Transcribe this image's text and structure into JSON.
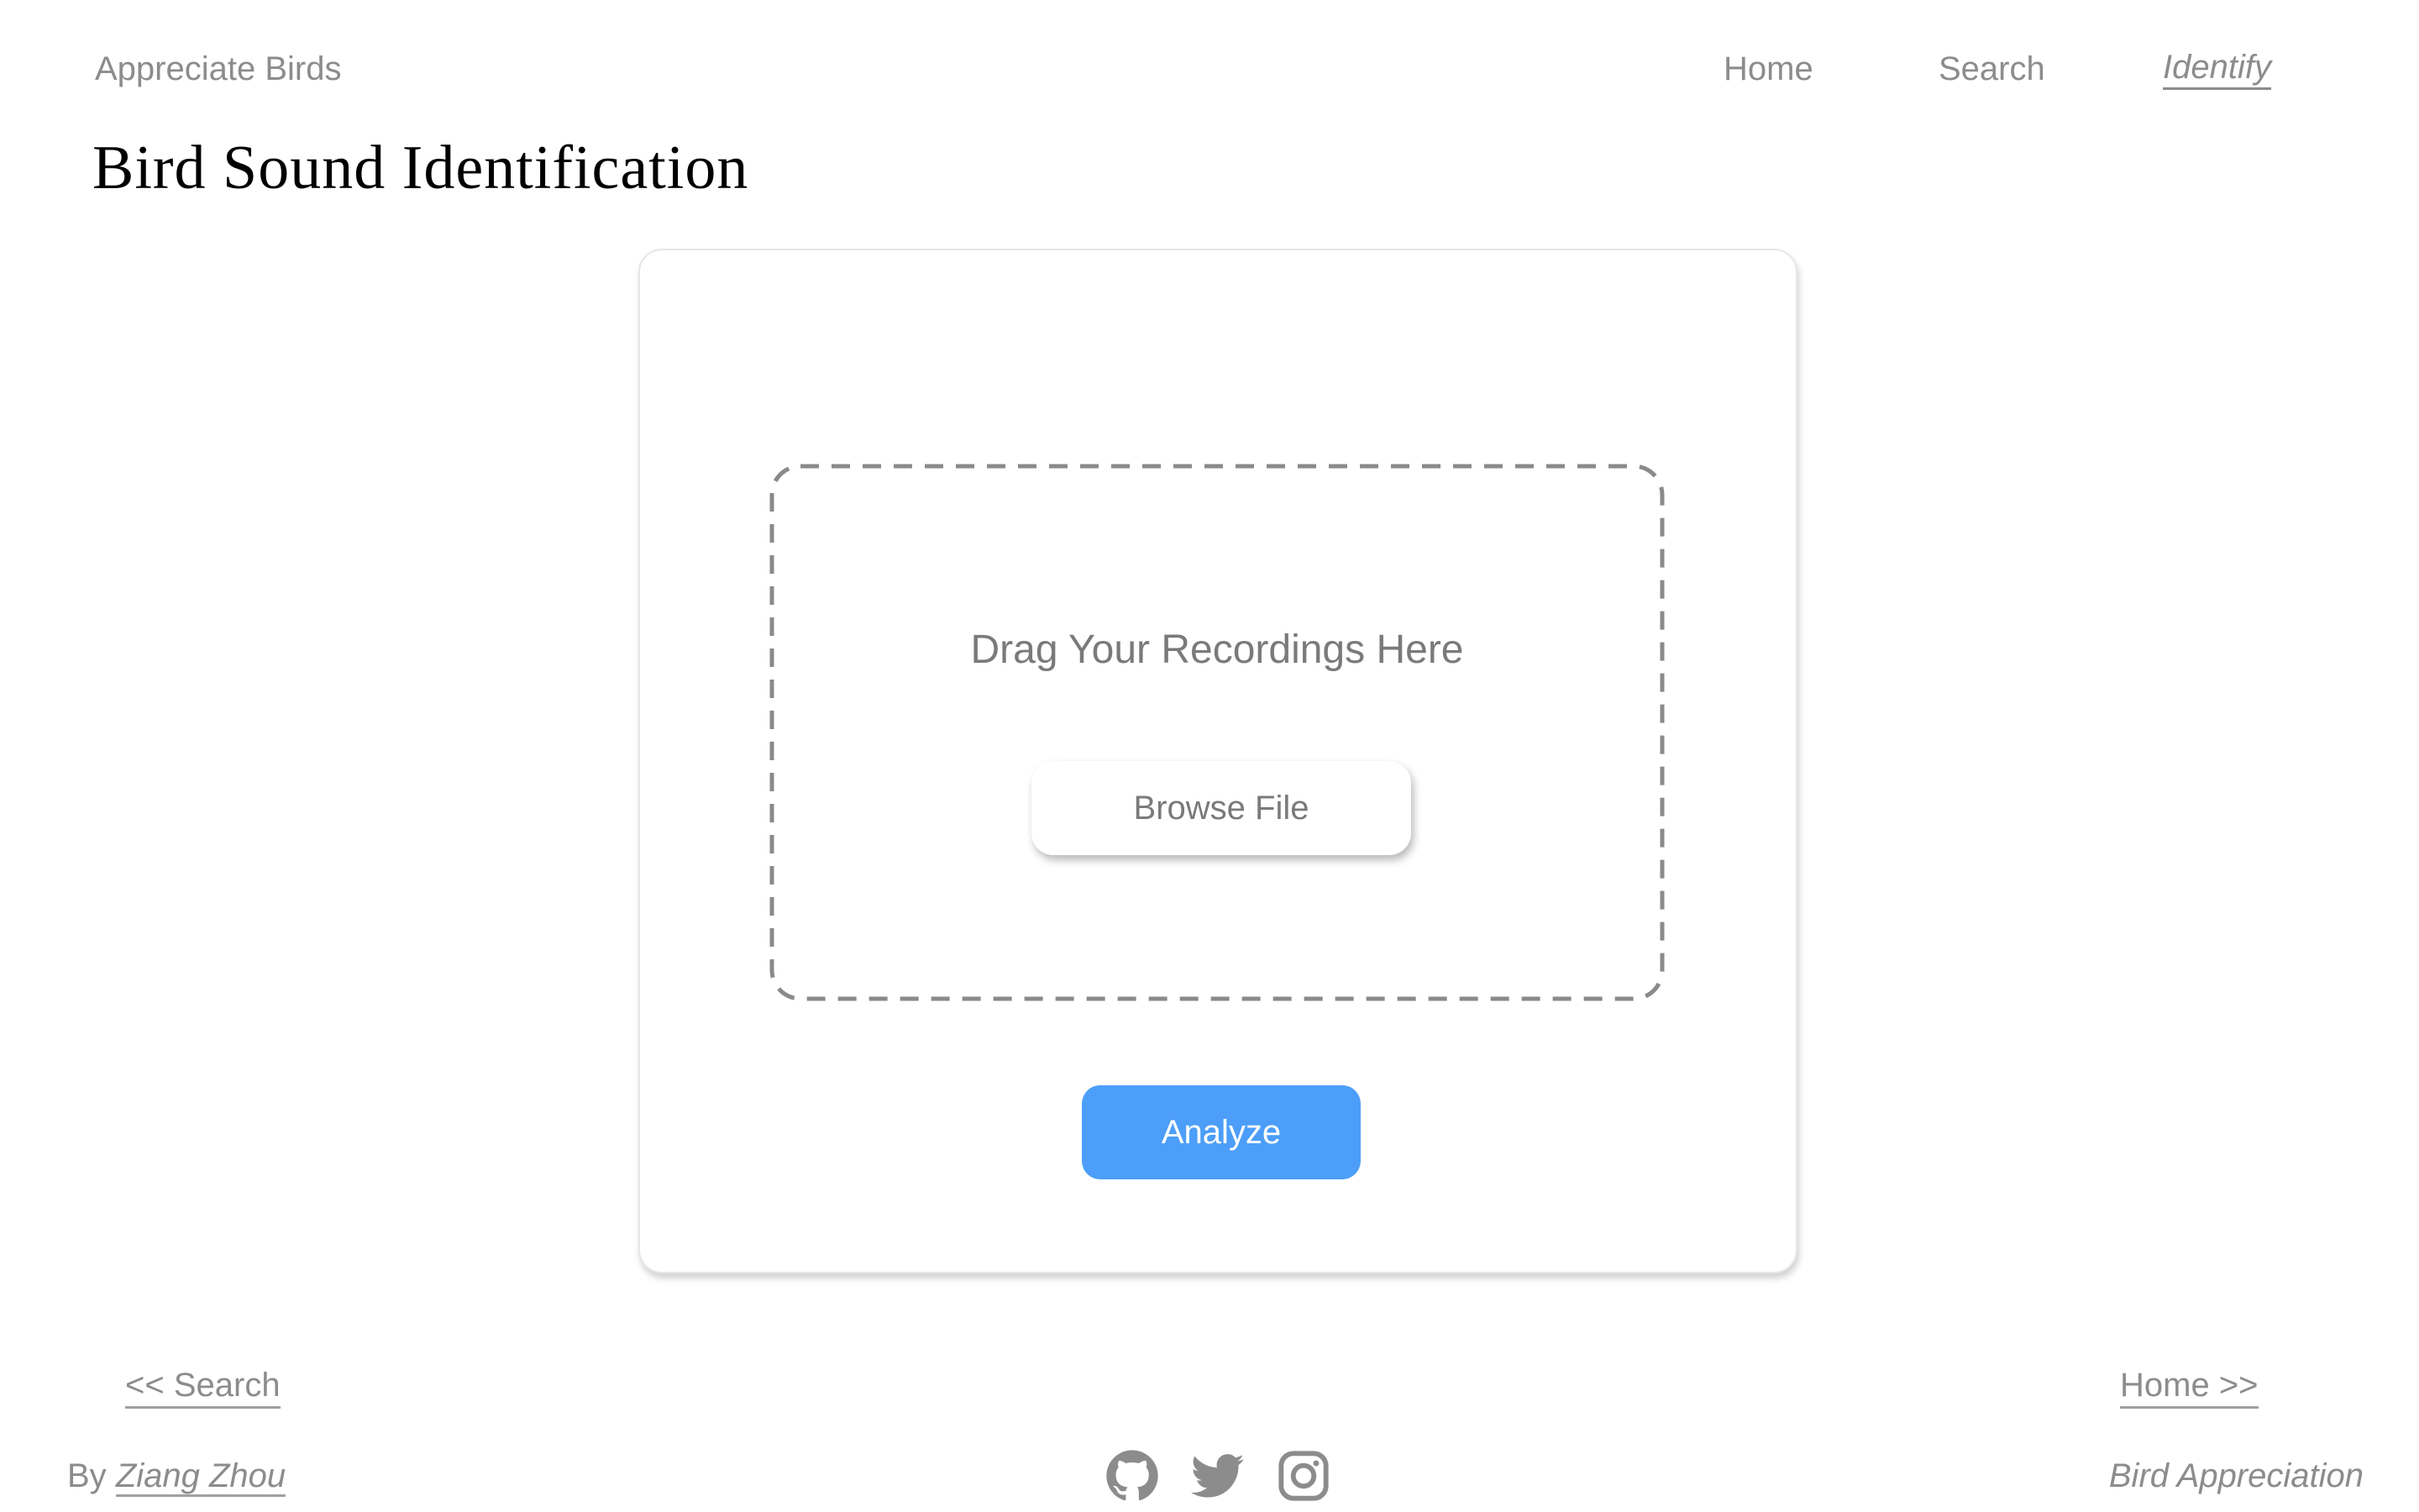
{
  "header": {
    "brand": "Appreciate Birds",
    "nav": {
      "home": "Home",
      "search": "Search",
      "identify": "Identify"
    },
    "active_nav": "identify"
  },
  "page": {
    "title": "Bird Sound Identification"
  },
  "upload": {
    "drop_text": "Drag Your Recordings Here",
    "browse_label": "Browse File",
    "analyze_label": "Analyze"
  },
  "pager": {
    "prev": "<< Search",
    "next": "Home >>"
  },
  "footer": {
    "by_prefix": "By",
    "author": "Ziang Zhou",
    "site_name": "Bird Appreciation",
    "social_icons": [
      "github-icon",
      "twitter-icon",
      "instagram-icon"
    ]
  },
  "colors": {
    "text_gray": "#8c8c8c",
    "accent_blue": "#4c9ef8",
    "title_black": "#000000",
    "dash_gray": "#8a8a8a"
  }
}
